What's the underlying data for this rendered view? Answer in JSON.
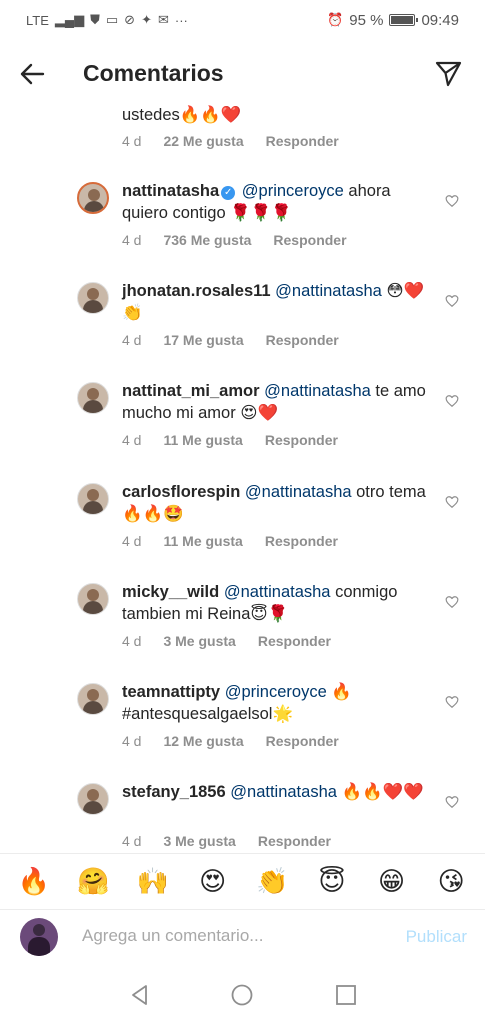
{
  "status_bar": {
    "network": "LTE",
    "battery_percent": "95 %",
    "battery_level": 0.95,
    "time": "09:49"
  },
  "header": {
    "title": "Comentarios"
  },
  "partial_comment": {
    "text": "ustedes🔥🔥❤️",
    "age": "4 d",
    "likes": "22 Me gusta",
    "reply": "Responder"
  },
  "comments": [
    {
      "user": "nattinatasha",
      "verified": true,
      "mention": "@princeroyce",
      "text": " ahora quiero contigo 🌹🌹🌹",
      "age": "4 d",
      "likes": "736 Me gusta",
      "reply": "Responder"
    },
    {
      "user": "jhonatan.rosales11",
      "verified": false,
      "mention": "@nattinatasha",
      "text": " 😳❤️👏",
      "age": "4 d",
      "likes": "17 Me gusta",
      "reply": "Responder"
    },
    {
      "user": "nattinat_mi_amor",
      "verified": false,
      "mention": "@nattinatasha",
      "text": " te amo mucho mi amor 😍❤️",
      "age": "4 d",
      "likes": "11 Me gusta",
      "reply": "Responder"
    },
    {
      "user": "carlosflorespin",
      "verified": false,
      "mention": "@nattinatasha",
      "text": " otro tema 🔥🔥🤩",
      "age": "4 d",
      "likes": "11 Me gusta",
      "reply": "Responder"
    },
    {
      "user": "micky__wild",
      "verified": false,
      "mention": "@nattinatasha",
      "text": " conmigo tambien mi Reina😇🌹",
      "age": "4 d",
      "likes": "3 Me gusta",
      "reply": "Responder"
    },
    {
      "user": "teamnattipty",
      "verified": false,
      "mention": "@princeroyce",
      "text": " 🔥 #antesquesalgaelsol🌟",
      "age": "4 d",
      "likes": "12 Me gusta",
      "reply": "Responder"
    },
    {
      "user": "stefany_1856",
      "verified": false,
      "mention": "@nattinatasha",
      "text": " 🔥🔥❤️❤️",
      "age": "4 d",
      "likes": "3 Me gusta",
      "reply": "Responder"
    }
  ],
  "emoji_bar": [
    "🔥",
    "🤗",
    "🙌",
    "😍",
    "👏",
    "😇",
    "😁",
    "😘"
  ],
  "input": {
    "placeholder": "Agrega un comentario...",
    "publish_label": "Publicar"
  },
  "colors": {
    "mention": "#00376b",
    "verified": "#3897f0",
    "publish_disabled": "#b2dffc"
  }
}
